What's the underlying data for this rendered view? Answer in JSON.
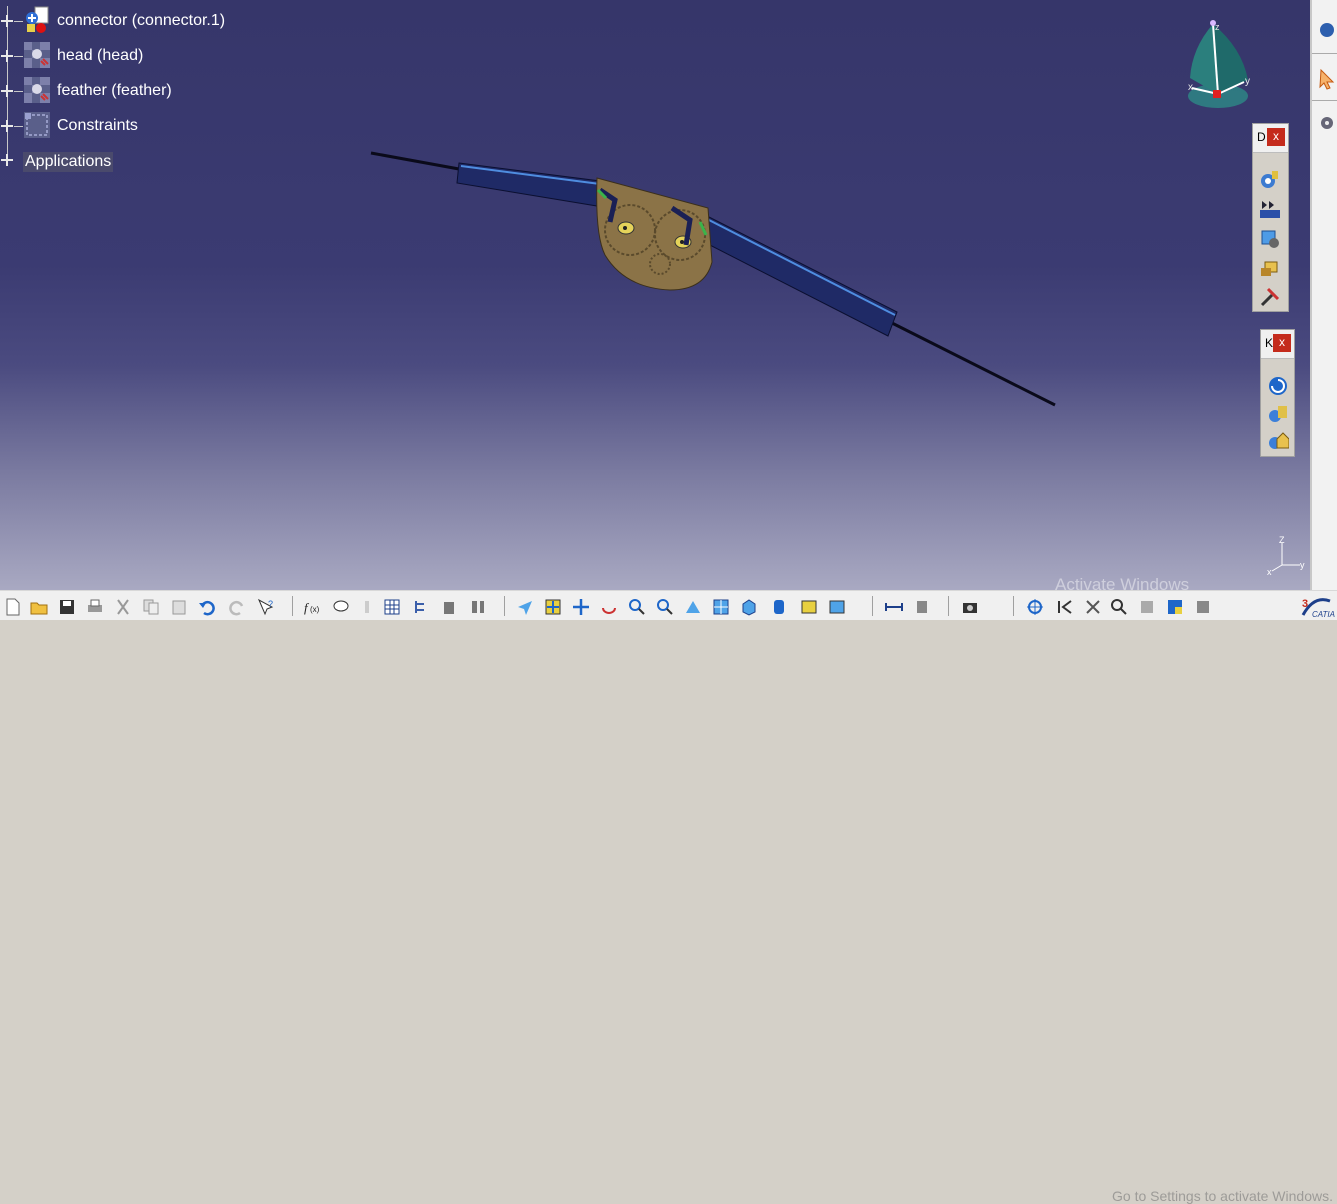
{
  "tree": {
    "items": [
      {
        "label": "connector (connector.1)",
        "icon": "product-icon"
      },
      {
        "label": "head (head)",
        "icon": "part-icon"
      },
      {
        "label": "feather (feather)",
        "icon": "part-icon"
      },
      {
        "label": "Constraints",
        "icon": "constraints-icon"
      },
      {
        "label": "Applications",
        "icon": "none"
      }
    ]
  },
  "compass": {
    "x_label": "x",
    "y_label": "y",
    "z_label": "z"
  },
  "axis_triad": {
    "x_label": "x",
    "y_label": "y",
    "z_label": "Z"
  },
  "toolbars": {
    "floating_1": {
      "title": "D",
      "close": "x"
    },
    "floating_2": {
      "title": "K",
      "close": "x"
    }
  },
  "watermark": {
    "line1": "Activate Windows",
    "line2": "Go to Settings to activate Windows."
  },
  "brand": {
    "name": "CATIA"
  },
  "colors": {
    "background_top": "#36366a",
    "background_bottom": "#a9a9c2",
    "close_button": "#c42b1c",
    "plate": "#8b7347",
    "bar": "#1f2a66"
  }
}
